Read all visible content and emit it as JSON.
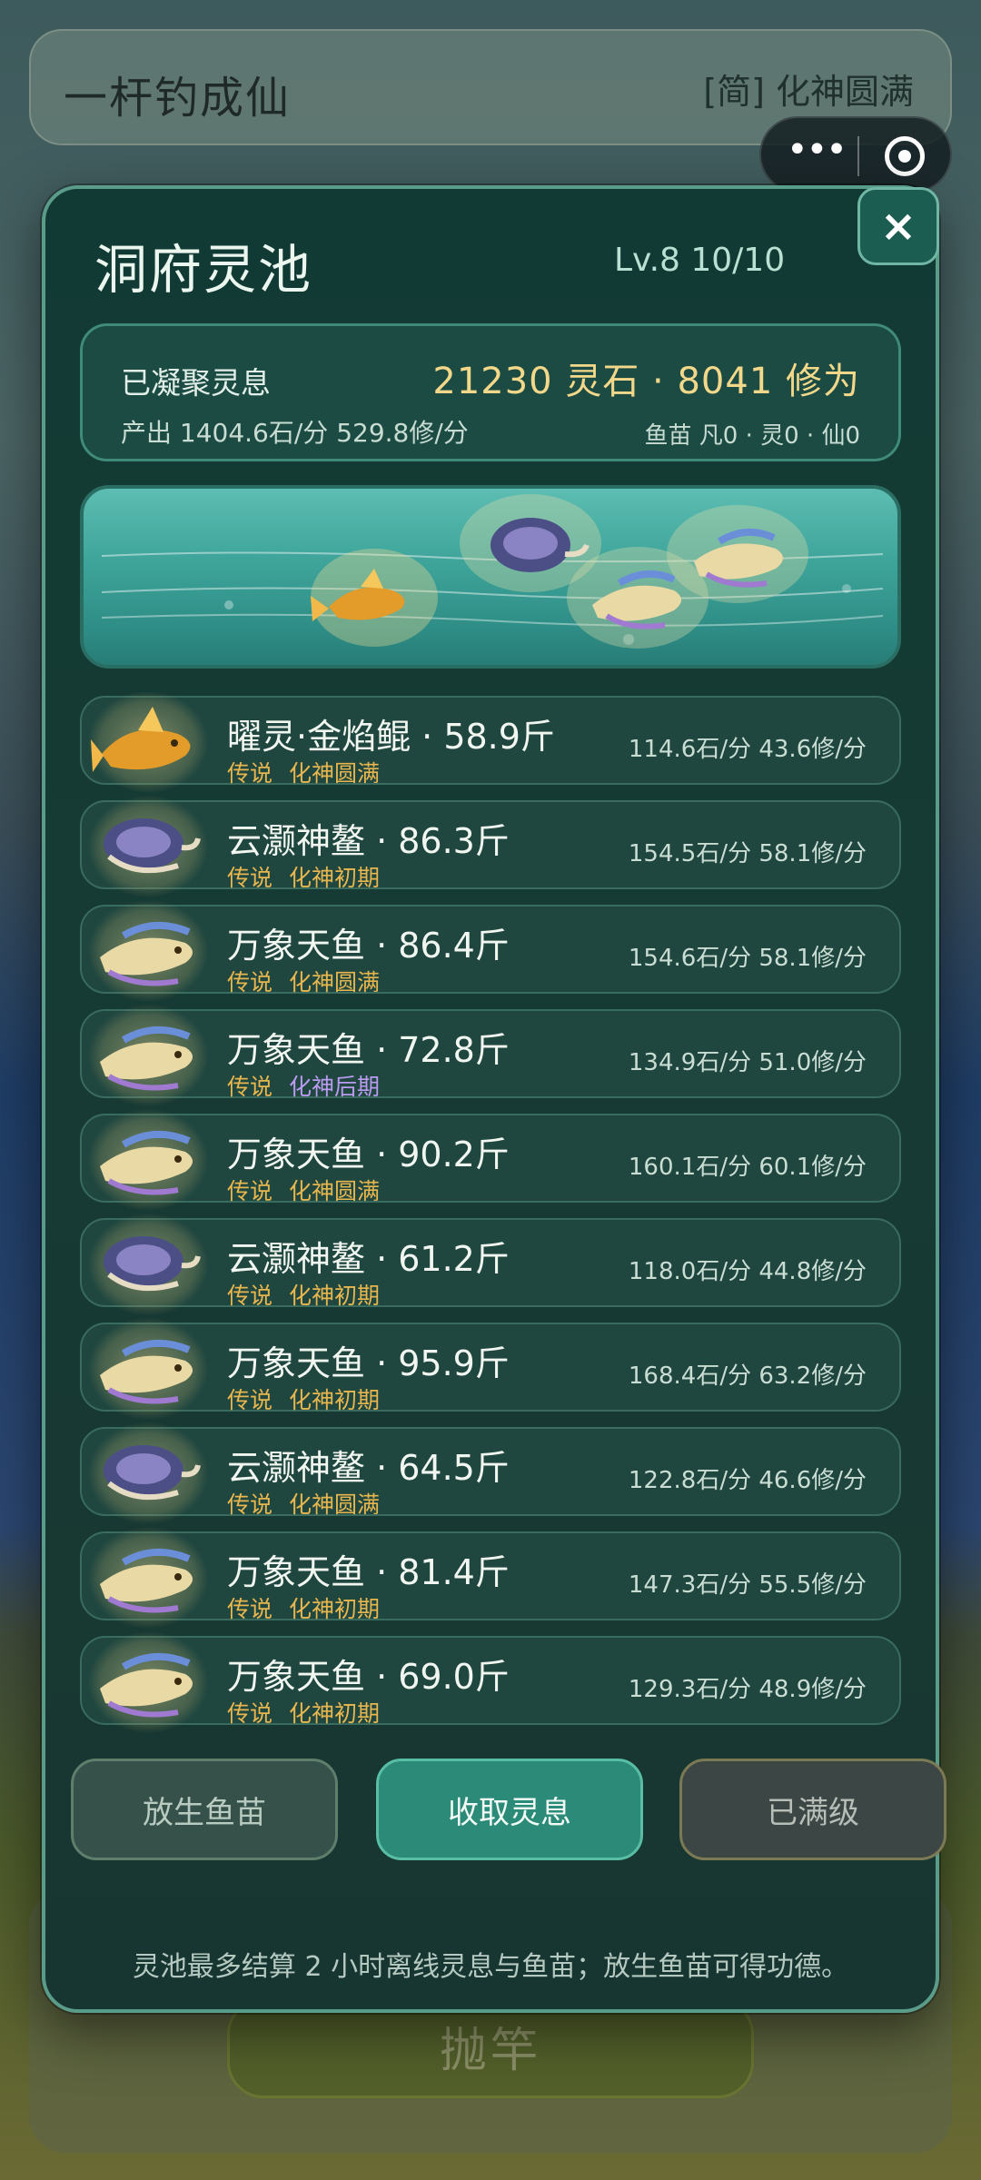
{
  "header": {
    "game_title": "一杆钓成仙",
    "realm": "[简] 化神圆满"
  },
  "capsule": {
    "menu_icon": "more-dots-icon",
    "close_icon": "target-icon"
  },
  "background": {
    "cast_button": "抛竿"
  },
  "modal": {
    "title": "洞府灵池",
    "level": "Lv.8  10/10",
    "close_label": "×",
    "stats": {
      "label": "已凝聚灵息",
      "totals": "21230 灵石 · 8041 修为",
      "rate": "产出 1404.6石/分  529.8修/分",
      "fry": "鱼苗 凡0 · 灵0 · 仙0"
    },
    "fish": [
      {
        "name": "曜灵·金焰鲲 · 58.9斤",
        "tier": "传说",
        "realm": "化神圆满",
        "yield": "114.6石/分 43.6修/分",
        "kind": "gold",
        "late": false
      },
      {
        "name": "云灏神鳌 · 86.3斤",
        "tier": "传说",
        "realm": "化神初期",
        "yield": "154.5石/分 58.1修/分",
        "kind": "turtle",
        "late": false
      },
      {
        "name": "万象天鱼 · 86.4斤",
        "tier": "传说",
        "realm": "化神圆满",
        "yield": "154.6石/分 58.1修/分",
        "kind": "rainbow",
        "late": false
      },
      {
        "name": "万象天鱼 · 72.8斤",
        "tier": "传说",
        "realm": "化神后期",
        "yield": "134.9石/分 51.0修/分",
        "kind": "rainbow",
        "late": true
      },
      {
        "name": "万象天鱼 · 90.2斤",
        "tier": "传说",
        "realm": "化神圆满",
        "yield": "160.1石/分 60.1修/分",
        "kind": "rainbow",
        "late": false
      },
      {
        "name": "云灏神鳌 · 61.2斤",
        "tier": "传说",
        "realm": "化神初期",
        "yield": "118.0石/分 44.8修/分",
        "kind": "turtle",
        "late": false
      },
      {
        "name": "万象天鱼 · 95.9斤",
        "tier": "传说",
        "realm": "化神初期",
        "yield": "168.4石/分 63.2修/分",
        "kind": "rainbow",
        "late": false
      },
      {
        "name": "云灏神鳌 · 64.5斤",
        "tier": "传说",
        "realm": "化神圆满",
        "yield": "122.8石/分 46.6修/分",
        "kind": "turtle",
        "late": false
      },
      {
        "name": "万象天鱼 · 81.4斤",
        "tier": "传说",
        "realm": "化神初期",
        "yield": "147.3石/分 55.5修/分",
        "kind": "rainbow",
        "late": false
      },
      {
        "name": "万象天鱼 · 69.0斤",
        "tier": "传说",
        "realm": "化神初期",
        "yield": "129.3石/分 48.9修/分",
        "kind": "rainbow",
        "late": false
      }
    ],
    "buttons": {
      "release": "放生鱼苗",
      "collect": "收取灵息",
      "maxed": "已满级"
    },
    "footnote": "灵池最多结算 2 小时离线灵息与鱼苗；放生鱼苗可得功德。"
  },
  "colors": {
    "accent": "#2c8a78",
    "gold_text": "#f3d88a",
    "tier_legend": "#e8b64e",
    "realm_late": "#b99bf0"
  }
}
